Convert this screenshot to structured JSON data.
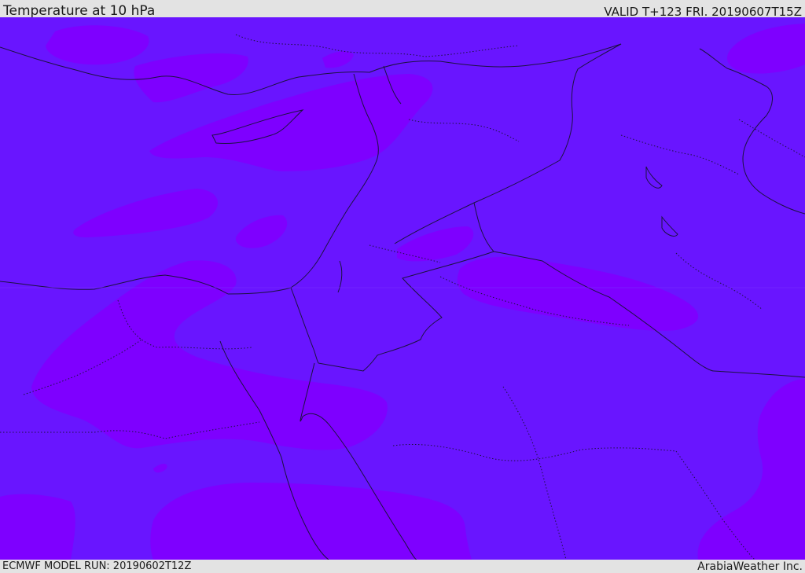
{
  "header": {
    "title": "Temperature at 10 hPa",
    "valid": "VALID T+123 FRI. 20190607T15Z"
  },
  "footer": {
    "model_run": "ECMWF MODEL RUN: 20190602T12Z",
    "brand": "ArabiaWeather Inc."
  },
  "map": {
    "field": "temperature",
    "level": "10 hPa",
    "colors": {
      "base": "#6915ff",
      "warm": "#7e00ff",
      "coastline": "#1c1240",
      "border": "#1c1240"
    }
  }
}
